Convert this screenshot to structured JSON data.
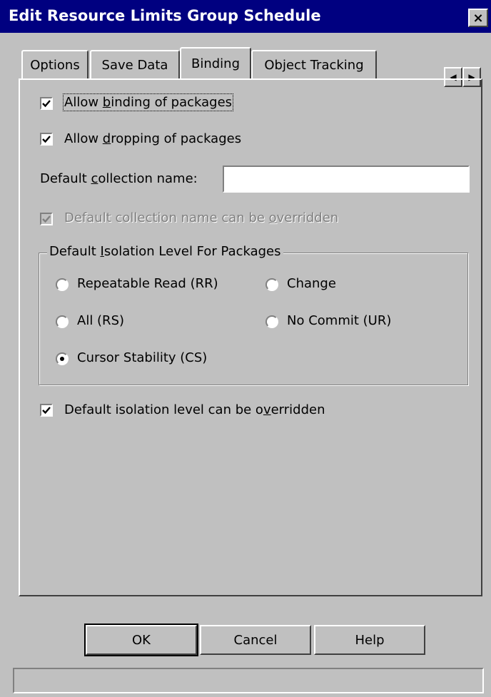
{
  "window": {
    "title": "Edit Resource Limits Group Schedule",
    "close_glyph": "×"
  },
  "tabs": [
    {
      "label": "Options",
      "active": false
    },
    {
      "label": "Save Data",
      "active": false
    },
    {
      "label": "Binding",
      "active": true
    },
    {
      "label": "Object Tracking",
      "active": false
    }
  ],
  "tab_scroll": {
    "left_glyph": "◀",
    "right_glyph": "▶"
  },
  "binding": {
    "allow_binding": {
      "pre": "Allow ",
      "mnemonic": "b",
      "post": "inding of packages",
      "checked": true
    },
    "allow_dropping": {
      "pre": "Allow ",
      "mnemonic": "d",
      "post": "ropping of packages",
      "checked": true
    },
    "collection": {
      "pre": "Default ",
      "mnemonic": "c",
      "post": "ollection name:",
      "value": ""
    },
    "collection_override": {
      "pre": "Default collection name can be ",
      "mnemonic": "o",
      "post": "verridden",
      "checked": true,
      "enabled": false
    },
    "isolation_group": {
      "pre": "Default ",
      "mnemonic": "I",
      "post": "solation Level For Packages"
    },
    "isolation_options": [
      {
        "label": "Repeatable Read (RR)",
        "selected": false
      },
      {
        "label": "Change",
        "selected": false
      },
      {
        "label": "All (RS)",
        "selected": false
      },
      {
        "label": "No Commit (UR)",
        "selected": false
      },
      {
        "label": "Cursor Stability (CS)",
        "selected": true
      }
    ],
    "isolation_override": {
      "pre": "Default isolation level can be o",
      "mnemonic": "v",
      "post": "erridden",
      "checked": true
    }
  },
  "buttons": {
    "ok": "OK",
    "cancel": "Cancel",
    "help": "Help"
  },
  "status": {
    "text": ""
  }
}
